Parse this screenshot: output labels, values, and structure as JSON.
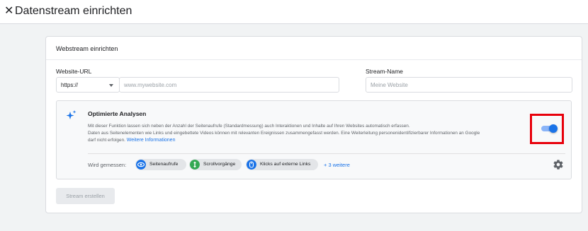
{
  "header": {
    "close_icon": "close-icon",
    "title": "Datenstream einrichten"
  },
  "card": {
    "title": "Webstream einrichten",
    "website_url": {
      "label": "Website-URL",
      "protocol_value": "https://",
      "placeholder": "www.mywebsite.com"
    },
    "stream_name": {
      "label": "Stream-Name",
      "placeholder": "Meine Website"
    },
    "enhanced_analytics": {
      "icon": "sparkle-icon",
      "title": "Optimierte Analysen",
      "desc_line1": "Mit dieser Funktion lassen sich neben der Anzahl der Seitenaufrufe (Standardmessung) auch Interaktionen und Inhalte auf Ihren Websites automatisch erfassen.",
      "desc_line2": "Daten aus Seitenelementen wie Links und eingebettete Videos können mit relevanten Ereignissen zusammengefasst werden. Eine Weiterleitung personenidentifizierbarer Informationen an Google",
      "desc_line3": "darf nicht erfolgen.",
      "link_text": "Weitere Informationen",
      "toggle_on": true,
      "measured_label": "Wird gemessen:",
      "chips": [
        {
          "label": "Seitenaufrufe",
          "icon": "eye-icon",
          "color": "#1a73e8"
        },
        {
          "label": "Scrollvorgänge",
          "icon": "scroll-icon",
          "color": "#34a853"
        },
        {
          "label": "Klicks auf externe Links",
          "icon": "mouse-click-icon",
          "color": "#1a73e8"
        }
      ],
      "more_link": "+ 3 weitere",
      "settings_icon": "gear-icon"
    },
    "create_button": "Stream erstellen"
  },
  "colors": {
    "accent": "#1a73e8",
    "highlight": "#e8000b"
  }
}
